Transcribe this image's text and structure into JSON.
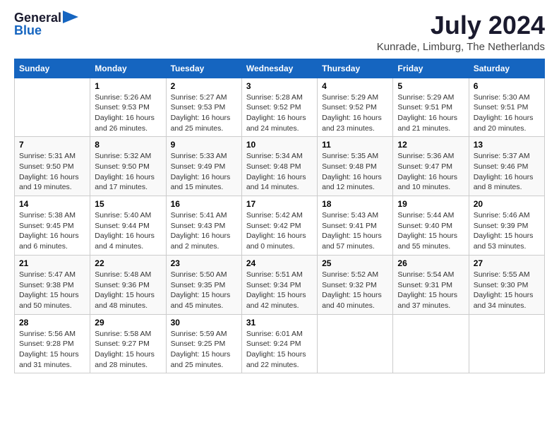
{
  "header": {
    "logo_general": "General",
    "logo_blue": "Blue",
    "month_title": "July 2024",
    "location": "Kunrade, Limburg, The Netherlands"
  },
  "calendar": {
    "days_of_week": [
      "Sunday",
      "Monday",
      "Tuesday",
      "Wednesday",
      "Thursday",
      "Friday",
      "Saturday"
    ],
    "weeks": [
      [
        {
          "day": "",
          "content": ""
        },
        {
          "day": "1",
          "content": "Sunrise: 5:26 AM\nSunset: 9:53 PM\nDaylight: 16 hours\nand 26 minutes."
        },
        {
          "day": "2",
          "content": "Sunrise: 5:27 AM\nSunset: 9:53 PM\nDaylight: 16 hours\nand 25 minutes."
        },
        {
          "day": "3",
          "content": "Sunrise: 5:28 AM\nSunset: 9:52 PM\nDaylight: 16 hours\nand 24 minutes."
        },
        {
          "day": "4",
          "content": "Sunrise: 5:29 AM\nSunset: 9:52 PM\nDaylight: 16 hours\nand 23 minutes."
        },
        {
          "day": "5",
          "content": "Sunrise: 5:29 AM\nSunset: 9:51 PM\nDaylight: 16 hours\nand 21 minutes."
        },
        {
          "day": "6",
          "content": "Sunrise: 5:30 AM\nSunset: 9:51 PM\nDaylight: 16 hours\nand 20 minutes."
        }
      ],
      [
        {
          "day": "7",
          "content": "Sunrise: 5:31 AM\nSunset: 9:50 PM\nDaylight: 16 hours\nand 19 minutes."
        },
        {
          "day": "8",
          "content": "Sunrise: 5:32 AM\nSunset: 9:50 PM\nDaylight: 16 hours\nand 17 minutes."
        },
        {
          "day": "9",
          "content": "Sunrise: 5:33 AM\nSunset: 9:49 PM\nDaylight: 16 hours\nand 15 minutes."
        },
        {
          "day": "10",
          "content": "Sunrise: 5:34 AM\nSunset: 9:48 PM\nDaylight: 16 hours\nand 14 minutes."
        },
        {
          "day": "11",
          "content": "Sunrise: 5:35 AM\nSunset: 9:48 PM\nDaylight: 16 hours\nand 12 minutes."
        },
        {
          "day": "12",
          "content": "Sunrise: 5:36 AM\nSunset: 9:47 PM\nDaylight: 16 hours\nand 10 minutes."
        },
        {
          "day": "13",
          "content": "Sunrise: 5:37 AM\nSunset: 9:46 PM\nDaylight: 16 hours\nand 8 minutes."
        }
      ],
      [
        {
          "day": "14",
          "content": "Sunrise: 5:38 AM\nSunset: 9:45 PM\nDaylight: 16 hours\nand 6 minutes."
        },
        {
          "day": "15",
          "content": "Sunrise: 5:40 AM\nSunset: 9:44 PM\nDaylight: 16 hours\nand 4 minutes."
        },
        {
          "day": "16",
          "content": "Sunrise: 5:41 AM\nSunset: 9:43 PM\nDaylight: 16 hours\nand 2 minutes."
        },
        {
          "day": "17",
          "content": "Sunrise: 5:42 AM\nSunset: 9:42 PM\nDaylight: 16 hours\nand 0 minutes."
        },
        {
          "day": "18",
          "content": "Sunrise: 5:43 AM\nSunset: 9:41 PM\nDaylight: 15 hours\nand 57 minutes."
        },
        {
          "day": "19",
          "content": "Sunrise: 5:44 AM\nSunset: 9:40 PM\nDaylight: 15 hours\nand 55 minutes."
        },
        {
          "day": "20",
          "content": "Sunrise: 5:46 AM\nSunset: 9:39 PM\nDaylight: 15 hours\nand 53 minutes."
        }
      ],
      [
        {
          "day": "21",
          "content": "Sunrise: 5:47 AM\nSunset: 9:38 PM\nDaylight: 15 hours\nand 50 minutes."
        },
        {
          "day": "22",
          "content": "Sunrise: 5:48 AM\nSunset: 9:36 PM\nDaylight: 15 hours\nand 48 minutes."
        },
        {
          "day": "23",
          "content": "Sunrise: 5:50 AM\nSunset: 9:35 PM\nDaylight: 15 hours\nand 45 minutes."
        },
        {
          "day": "24",
          "content": "Sunrise: 5:51 AM\nSunset: 9:34 PM\nDaylight: 15 hours\nand 42 minutes."
        },
        {
          "day": "25",
          "content": "Sunrise: 5:52 AM\nSunset: 9:32 PM\nDaylight: 15 hours\nand 40 minutes."
        },
        {
          "day": "26",
          "content": "Sunrise: 5:54 AM\nSunset: 9:31 PM\nDaylight: 15 hours\nand 37 minutes."
        },
        {
          "day": "27",
          "content": "Sunrise: 5:55 AM\nSunset: 9:30 PM\nDaylight: 15 hours\nand 34 minutes."
        }
      ],
      [
        {
          "day": "28",
          "content": "Sunrise: 5:56 AM\nSunset: 9:28 PM\nDaylight: 15 hours\nand 31 minutes."
        },
        {
          "day": "29",
          "content": "Sunrise: 5:58 AM\nSunset: 9:27 PM\nDaylight: 15 hours\nand 28 minutes."
        },
        {
          "day": "30",
          "content": "Sunrise: 5:59 AM\nSunset: 9:25 PM\nDaylight: 15 hours\nand 25 minutes."
        },
        {
          "day": "31",
          "content": "Sunrise: 6:01 AM\nSunset: 9:24 PM\nDaylight: 15 hours\nand 22 minutes."
        },
        {
          "day": "",
          "content": ""
        },
        {
          "day": "",
          "content": ""
        },
        {
          "day": "",
          "content": ""
        }
      ]
    ]
  }
}
